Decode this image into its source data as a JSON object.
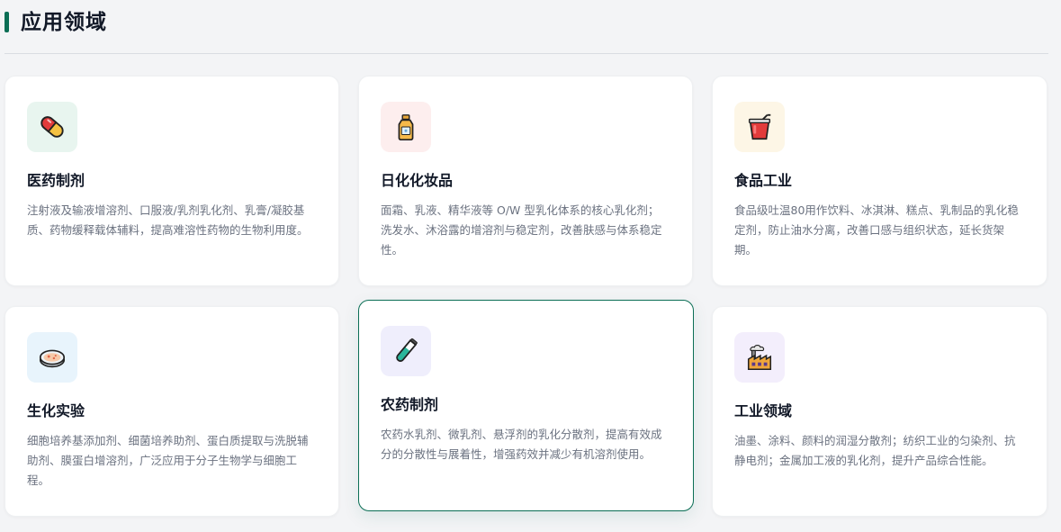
{
  "section": {
    "title": "应用领域",
    "accent": "#0b6e55"
  },
  "cards": [
    {
      "title": "医药制剂",
      "icon": "pill-icon",
      "icon_bg": "#e8f5ef",
      "desc": "注射液及输液增溶剂、口服液/乳剂乳化剂、乳膏/凝胶基质、药物缓释载体辅料，提高难溶性药物的生物利用度。"
    },
    {
      "title": "日化化妆品",
      "icon": "lotion-bottle-icon",
      "icon_bg": "#fdeeee",
      "desc": "面霜、乳液、精华液等 O/W 型乳化体系的核心乳化剂；洗发水、沐浴露的增溶剂与稳定剂，改善肤感与体系稳定性。"
    },
    {
      "title": "食品工业",
      "icon": "drink-cup-icon",
      "icon_bg": "#fdf6e6",
      "desc": "食品级吐温80用作饮料、冰淇淋、糕点、乳制品的乳化稳定剂，防止油水分离，改善口感与组织状态，延长货架期。"
    },
    {
      "title": "生化实验",
      "icon": "petri-dish-icon",
      "icon_bg": "#e8f4fc",
      "desc": "细胞培养基添加剂、细菌培养助剂、蛋白质提取与洗脱辅助剂、膜蛋白增溶剂，广泛应用于分子生物学与细胞工程。"
    },
    {
      "title": "农药制剂",
      "icon": "test-tube-icon",
      "icon_bg": "#efeefc",
      "desc": "农药水乳剂、微乳剂、悬浮剂的乳化分散剂，提高有效成分的分散性与展着性，增强药效并减少有机溶剂使用。"
    },
    {
      "title": "工业领域",
      "icon": "factory-icon",
      "icon_bg": "#f3eefc",
      "desc": "油墨、涂料、颜料的润湿分散剂；纺织工业的匀染剂、抗静电剂；金属加工液的乳化剂，提升产品综合性能。"
    }
  ]
}
